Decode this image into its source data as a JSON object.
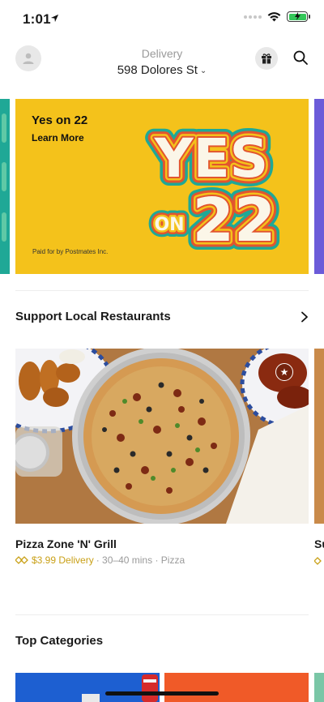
{
  "status_bar": {
    "time": "1:01"
  },
  "header": {
    "mode_label": "Delivery",
    "address": "598 Dolores St",
    "chevron": "⌄"
  },
  "promo": {
    "title": "Yes on 22",
    "cta": "Learn More",
    "art_line1": "YES",
    "art_line2_small": "ON",
    "art_line2_big": "22",
    "disclaimer": "Paid for by Postmates Inc.",
    "colors": {
      "background": "#f4c21b",
      "teal": "#1fa896",
      "red": "#e2552e",
      "purple": "#6b5bd9"
    }
  },
  "sections": {
    "support_local": "Support Local Restaurants",
    "top_categories": "Top Categories"
  },
  "restaurant": {
    "name": "Pizza Zone 'N' Grill",
    "delivery_fee": "$3.99 Delivery",
    "eta": "· 30–40 mins",
    "cuisine": "· Pizza",
    "next_card_name": "Su"
  }
}
